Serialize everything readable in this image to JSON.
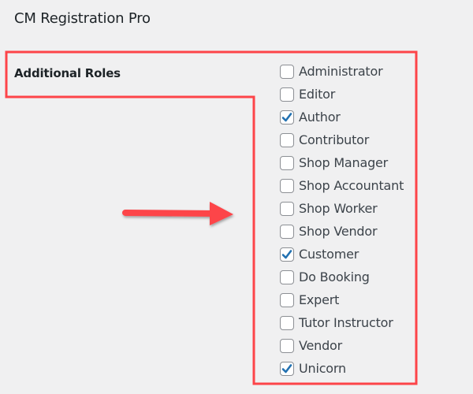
{
  "page": {
    "title": "CM Registration Pro",
    "field_label": "Additional Roles"
  },
  "annotation": {
    "outline_color": "#fd4449",
    "arrow_color": "#fd4449"
  },
  "roles": [
    {
      "label": "Administrator",
      "checked": false
    },
    {
      "label": "Editor",
      "checked": false
    },
    {
      "label": "Author",
      "checked": true
    },
    {
      "label": "Contributor",
      "checked": false
    },
    {
      "label": "Shop Manager",
      "checked": false
    },
    {
      "label": "Shop Accountant",
      "checked": false
    },
    {
      "label": "Shop Worker",
      "checked": false
    },
    {
      "label": "Shop Vendor",
      "checked": false
    },
    {
      "label": "Customer",
      "checked": true
    },
    {
      "label": "Do Booking",
      "checked": false
    },
    {
      "label": "Expert",
      "checked": false
    },
    {
      "label": "Tutor Instructor",
      "checked": false
    },
    {
      "label": "Vendor",
      "checked": false
    },
    {
      "label": "Unicorn",
      "checked": true
    }
  ],
  "colors": {
    "check": "#2271b1"
  }
}
